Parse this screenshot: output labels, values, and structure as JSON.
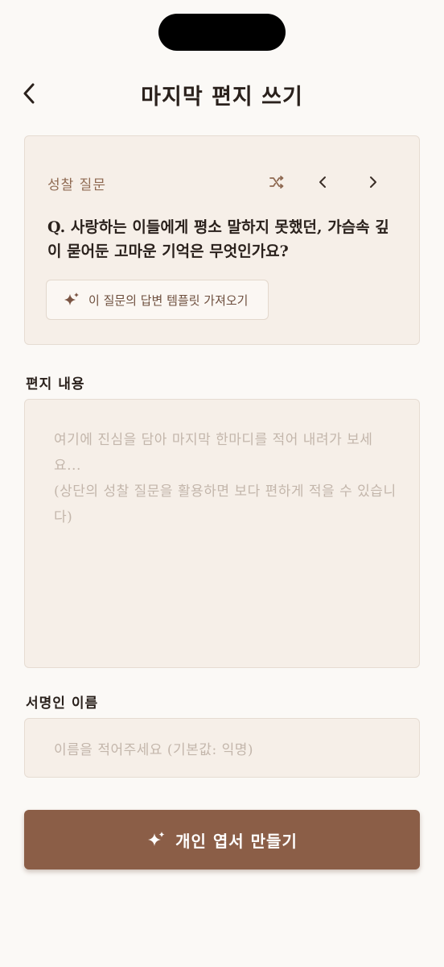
{
  "header": {
    "title": "마지막 편지 쓰기",
    "back_icon": "chevron-left-icon"
  },
  "question_card": {
    "label": "성찰 질문",
    "question": "Q. 사랑하는 이들에게 평소 말하지 못했던, 가슴속 깊이 묻어둔 고마운 기억은 무엇인가요?",
    "template_button_label": "이 질문의 답변 템플릿 가져오기",
    "icons": [
      "shuffle-icon",
      "chevron-left-icon",
      "chevron-right-icon",
      "sparkle-icon"
    ]
  },
  "letter": {
    "label": "편지 내용",
    "value": "",
    "placeholder": "여기에 진심을 담아 마지막 한마디를 적어 내려가 보세요...\n(상단의 성찰 질문을 활용하면 보다 편하게 적을 수 있습니다)"
  },
  "signer": {
    "label": "서명인 이름",
    "value": "",
    "placeholder": "이름을 적어주세요 (기본값: 익명)"
  },
  "submit": {
    "label": "개인 엽서 만들기"
  },
  "colors": {
    "background": "#fbf9f6",
    "card": "#f6efe8",
    "accent": "#8b5e47",
    "label_brown": "#8f6a52",
    "placeholder": "#c3b6ab"
  }
}
